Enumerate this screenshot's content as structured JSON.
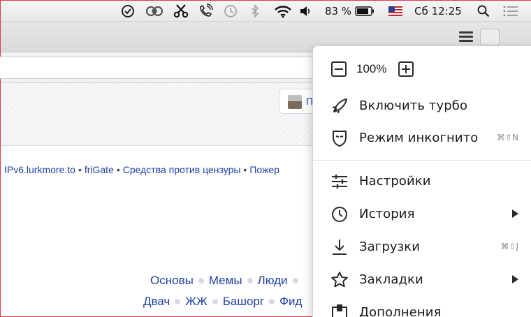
{
  "menubar": {
    "battery_percent": "83 %",
    "clock": "Сб 12:25"
  },
  "page": {
    "avatar_label": "П",
    "links_line": [
      {
        "text": "IPv6.lurkmore.to"
      },
      {
        "text": "friGate"
      },
      {
        "text": "Средства против цензуры"
      },
      {
        "text": "Пожер"
      }
    ],
    "links_separator": "•",
    "sections_row1": [
      "Основы",
      "Мемы",
      "Люди"
    ],
    "sections_row2": [
      "Двач",
      "ЖЖ",
      "Башорг",
      "Фид"
    ]
  },
  "menu": {
    "zoom_value": "100%",
    "items": [
      {
        "label": "Включить турбо",
        "shortcut": "",
        "icon": "rocket-icon"
      },
      {
        "label": "Режим инкогнито",
        "shortcut": "⌘⇧N",
        "icon": "incognito-mask-icon"
      },
      {
        "label": "Настройки",
        "shortcut": "",
        "icon": "settings-sliders-icon"
      },
      {
        "label": "История",
        "shortcut": "",
        "icon": "clock-icon",
        "submenu": true
      },
      {
        "label": "Загрузки",
        "shortcut": "⌘⇧J",
        "icon": "download-icon"
      },
      {
        "label": "Закладки",
        "shortcut": "",
        "icon": "star-icon",
        "submenu": true
      },
      {
        "label": "Дополнения",
        "shortcut": "",
        "icon": "extensions-icon"
      }
    ]
  }
}
